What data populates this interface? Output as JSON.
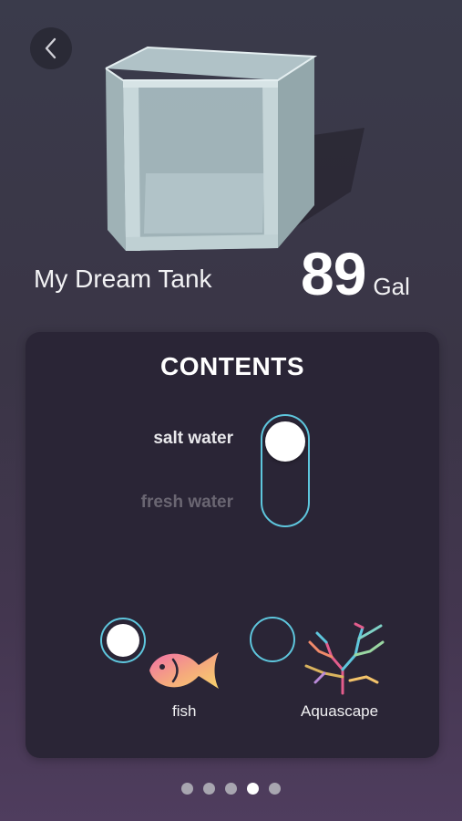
{
  "header": {
    "back_icon": "chevron-left-icon"
  },
  "tank": {
    "name": "My Dream Tank",
    "volume": "89",
    "unit": "Gal"
  },
  "contents": {
    "title": "CONTENTS",
    "water": {
      "options": [
        "salt water",
        "fresh water"
      ],
      "selected": "salt water"
    },
    "options": [
      {
        "label": "fish",
        "icon": "fish-icon",
        "selected": true
      },
      {
        "label": "Aquascape",
        "icon": "coral-icon",
        "selected": false
      }
    ]
  },
  "pagination": {
    "total": 5,
    "current": 4
  },
  "colors": {
    "accent": "#5ec6dd",
    "card": "#2a2536"
  }
}
